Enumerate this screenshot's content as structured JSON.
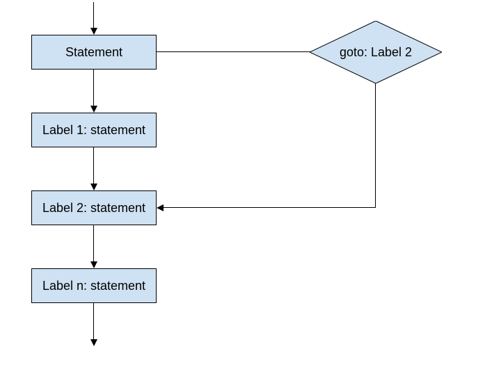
{
  "nodes": {
    "statement": "Statement",
    "label1": "Label 1: statement",
    "label2": "Label 2: statement",
    "labeln": "Label n: statement",
    "goto": "goto: Label 2"
  },
  "chart_data": {
    "type": "flowchart",
    "title": "",
    "nodes": [
      {
        "id": "statement",
        "label": "Statement",
        "shape": "rectangle"
      },
      {
        "id": "goto",
        "label": "goto: Label 2",
        "shape": "diamond"
      },
      {
        "id": "label1",
        "label": "Label 1: statement",
        "shape": "rectangle"
      },
      {
        "id": "label2",
        "label": "Label 2: statement",
        "shape": "rectangle"
      },
      {
        "id": "labeln",
        "label": "Label n: statement",
        "shape": "rectangle"
      }
    ],
    "edges": [
      {
        "from": "start",
        "to": "statement"
      },
      {
        "from": "statement",
        "to": "goto"
      },
      {
        "from": "statement",
        "to": "label1"
      },
      {
        "from": "label1",
        "to": "label2"
      },
      {
        "from": "goto",
        "to": "label2"
      },
      {
        "from": "label2",
        "to": "labeln"
      },
      {
        "from": "labeln",
        "to": "end"
      }
    ]
  }
}
